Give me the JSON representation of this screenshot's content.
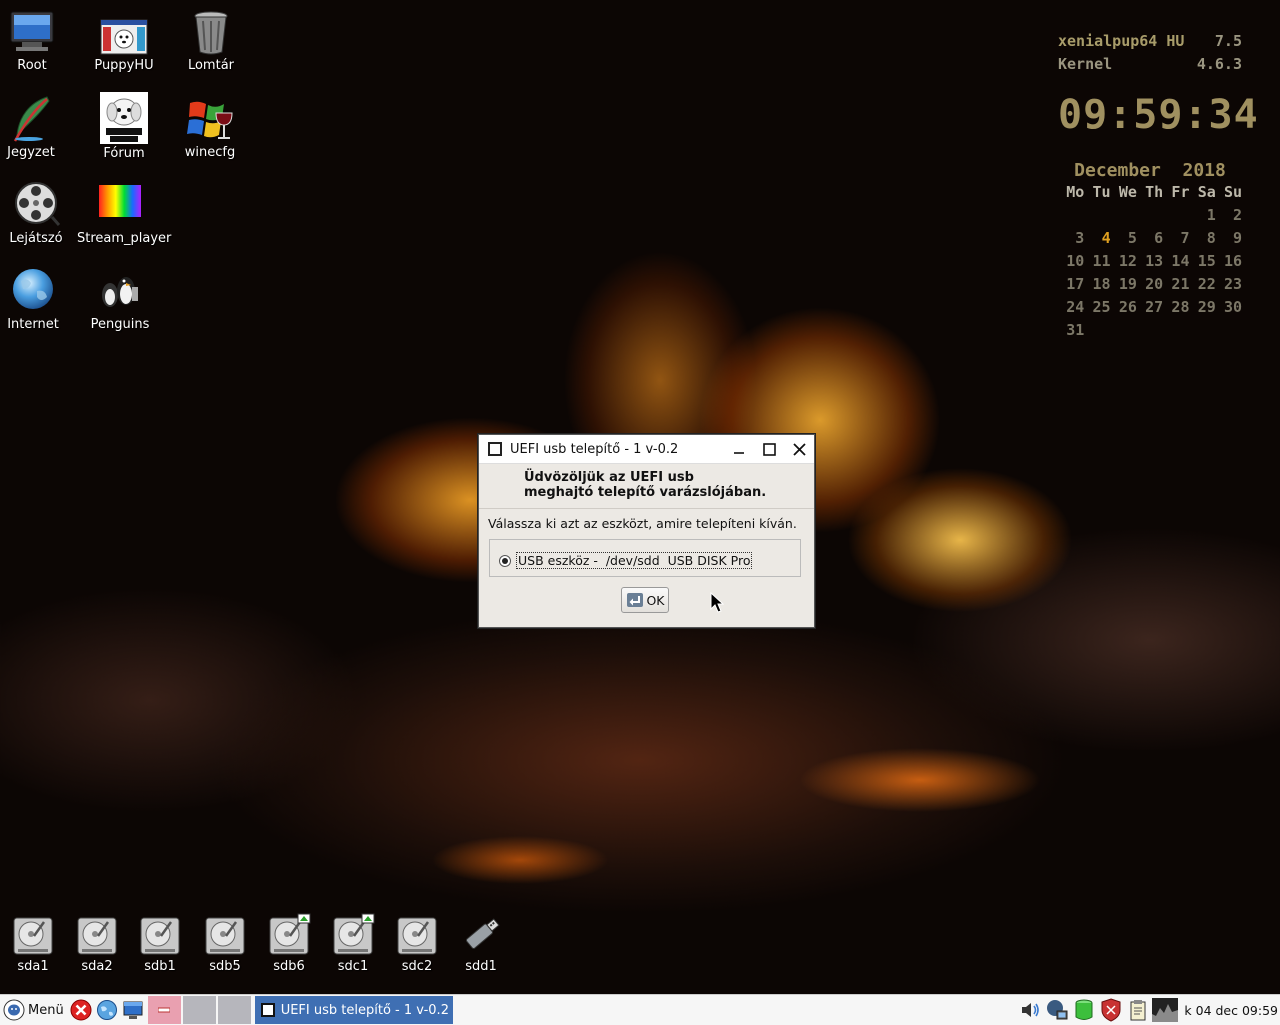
{
  "desktop_icons": {
    "root": "Root",
    "puppyhu": "PuppyHU",
    "lomtar": "Lomtár",
    "jegyzet": "Jegyzet",
    "forum": "Fórum",
    "winecfg": "winecfg",
    "lejatszo": "Lejátszó",
    "stream_player": "Stream_player",
    "internet": "Internet",
    "penguins": "Penguins"
  },
  "conky": {
    "distro_label": "xenialpup64 HU",
    "distro_version": "7.5",
    "kernel_label": "Kernel",
    "kernel_version": "4.6.3",
    "clock": "09:59:34",
    "calendar_title": "December  2018",
    "weekdays": [
      "Mo",
      "Tu",
      "We",
      "Th",
      "Fr",
      "Sa",
      "Su"
    ],
    "weeks": [
      [
        "",
        "",
        "",
        "",
        "",
        "1",
        "2"
      ],
      [
        "3",
        "4",
        "5",
        "6",
        "7",
        "8",
        "9"
      ],
      [
        "10",
        "11",
        "12",
        "13",
        "14",
        "15",
        "16"
      ],
      [
        "17",
        "18",
        "19",
        "20",
        "21",
        "22",
        "23"
      ],
      [
        "24",
        "25",
        "26",
        "27",
        "28",
        "29",
        "30"
      ],
      [
        "31",
        "",
        "",
        "",
        "",
        "",
        ""
      ]
    ],
    "today": "4"
  },
  "dialog": {
    "title": "UEFI usb telepítő - 1 v-0.2",
    "welcome_line1": "Üdvözöljük az UEFI usb",
    "welcome_line2": "meghajtó telepítő varázslójában.",
    "prompt": "Válassza ki azt az eszközt, amire telepíteni kíván.",
    "device_option": "USB eszköz -  /dev/sdd  USB DISK Pro",
    "ok_label": "OK"
  },
  "drives": [
    "sda1",
    "sda2",
    "sdb1",
    "sdb5",
    "sdb6",
    "sdc1",
    "sdc2",
    "sdd1"
  ],
  "taskbar": {
    "menu_label": "Menü",
    "task_label": "UEFI usb telepítő - 1 v-0.2",
    "clock": "k 04 dec 09:59"
  },
  "colors": {
    "taskbar_task": "#3f6fb3",
    "conky_text": "#a09060",
    "calendar_today": "#e0a020"
  }
}
